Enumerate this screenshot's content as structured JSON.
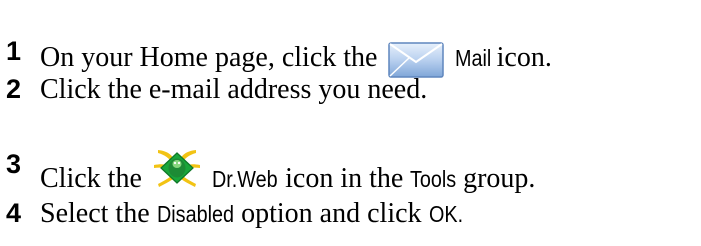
{
  "steps": [
    {
      "number": "1",
      "before": "On your Home page, click the",
      "ui_label": "Mail",
      "after": "icon.",
      "icon": "mail-envelope-icon"
    },
    {
      "number": "2",
      "text": "Click the e-mail address you need."
    },
    {
      "number": "3",
      "before": "Click the",
      "ui_label": "Dr.Web",
      "middle": "icon in the",
      "ui_label_2": "Tools",
      "after": "group.",
      "icon": "dr-web-spider-icon"
    },
    {
      "number": "4",
      "before": "Select the",
      "ui_label": "Disabled",
      "middle": "option and click",
      "ui_label_2": "OK."
    }
  ],
  "colors": {
    "text": "#000000",
    "mail_icon_top": "#dbe9f8",
    "mail_icon_bottom": "#7fa6d8",
    "mail_icon_border": "#5f86bd",
    "drweb_green": "#19a63a",
    "drweb_yellow": "#f2c314"
  }
}
